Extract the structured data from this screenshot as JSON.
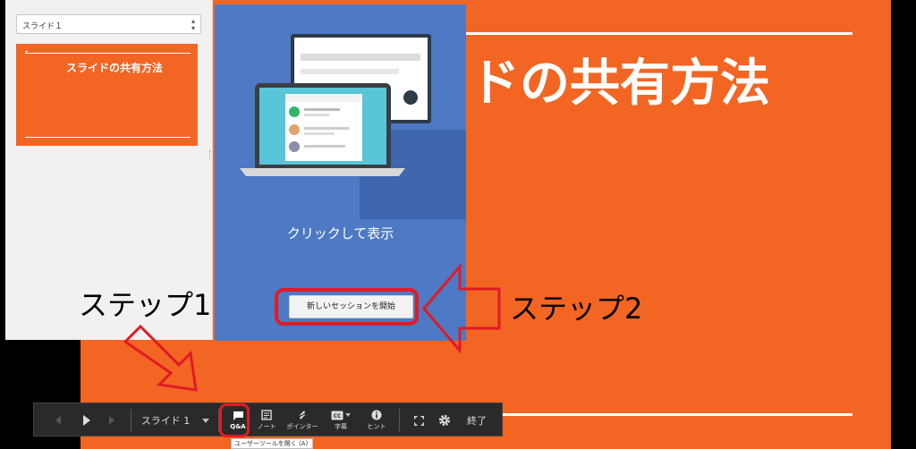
{
  "slide": {
    "title": "ドの共有方法",
    "background_color": "#f26522"
  },
  "sidebar": {
    "selector_value": "スライド１",
    "thumbnail_title": "スライドの共有方法"
  },
  "audience_panel": {
    "prompt_text": "クリックして表示",
    "new_session_button": "新しいセッションを開始",
    "background_color": "#4e79c4"
  },
  "annotations": {
    "step1": "ステップ1",
    "step2": "ステップ2",
    "highlight_color": "#e01b24"
  },
  "toolbar": {
    "slide_label": "スライド 1",
    "qa_label": "Q&A",
    "notes_label": "ノート",
    "pointer_label": "ポインター",
    "captions_label": "字幕",
    "hint_label": "ヒント",
    "end_label": "終了",
    "tooltip": "ユーザーツールを開く (A)"
  }
}
